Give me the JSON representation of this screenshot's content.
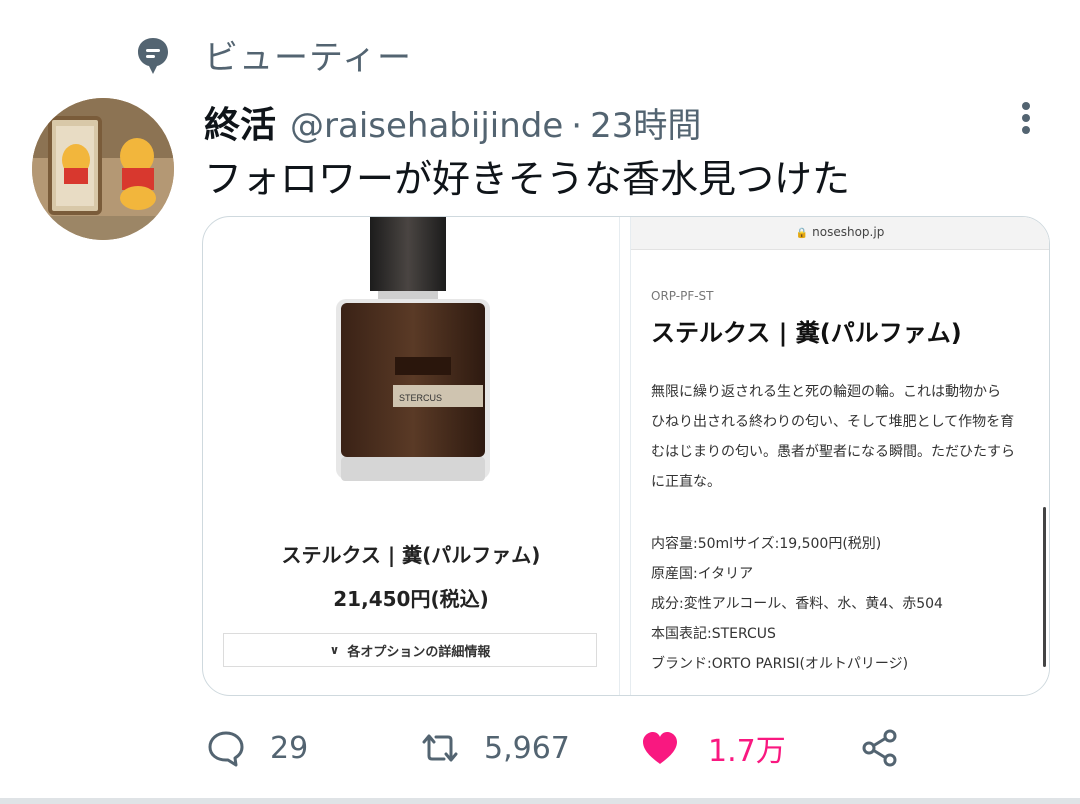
{
  "topic": {
    "icon": "topic-bubble-icon",
    "label": "ビューティー"
  },
  "tweet": {
    "display_name": "終活",
    "handle": "@raisehabijinde",
    "separator": "·",
    "time": "23時間",
    "text": "フォロワーが好きそうな香水見つけた"
  },
  "media": {
    "left": {
      "product_name": "ステルクス | 糞(パルファム)",
      "price": "21,450円(税込)",
      "options_label": "各オプションの詳細情報",
      "label_text": "STERCUS"
    },
    "right": {
      "url": "noseshop.jp",
      "sku": "ORP-PF-ST",
      "title": "ステルクス | 糞(パルファム)",
      "description": [
        "無限に繰り返される生と死の輪廻の輪。これは動物から",
        "ひねり出される終わりの匂い、そして堆肥として作物を育",
        "むはじまりの匂い。愚者が聖者になる瞬間。ただひたすら",
        "に正直な。"
      ],
      "specs": [
        "内容量:50mlサイズ:19,500円(税別)",
        "原産国:イタリア",
        "成分:変性アルコール、香料、水、黄4、赤504",
        "本国表記:STERCUS",
        "ブランド:ORTO PARISI(オルトパリージ)"
      ]
    }
  },
  "actions": {
    "reply_count": "29",
    "retweet_count": "5,967",
    "like_count": "1.7万",
    "like_color": "#f91880"
  }
}
